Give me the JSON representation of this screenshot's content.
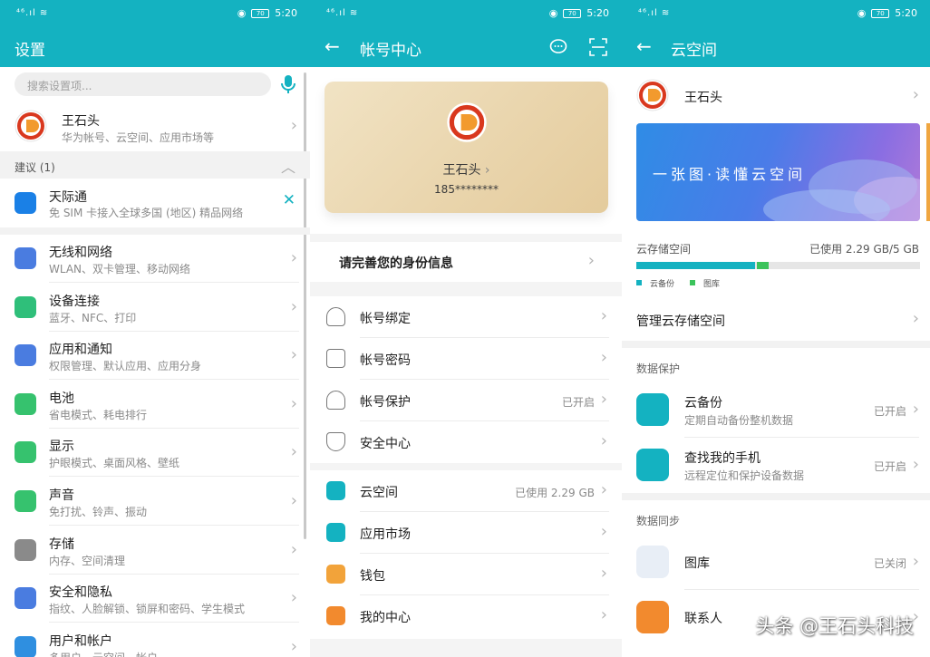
{
  "status": {
    "signal": "⁴⁶.ıl ≋",
    "time": "5:20",
    "battery": "70"
  },
  "settings": {
    "title": "设置",
    "search_placeholder": "搜索设置项...",
    "account": {
      "name": "王石头",
      "desc": "华为帐号、云空间、应用市场等"
    },
    "suggest_header": "建议 (1)",
    "suggest": {
      "title": "天际通",
      "desc": "免 SIM 卡接入全球多国 (地区) 精品网络"
    },
    "items": [
      {
        "title": "无线和网络",
        "desc": "WLAN、双卡管理、移动网络"
      },
      {
        "title": "设备连接",
        "desc": "蓝牙、NFC、打印"
      },
      {
        "title": "应用和通知",
        "desc": "权限管理、默认应用、应用分身"
      },
      {
        "title": "电池",
        "desc": "省电模式、耗电排行"
      },
      {
        "title": "显示",
        "desc": "护眼模式、桌面风格、壁纸"
      },
      {
        "title": "声音",
        "desc": "免打扰、铃声、振动"
      },
      {
        "title": "存储",
        "desc": "内存、空间清理"
      },
      {
        "title": "安全和隐私",
        "desc": "指纹、人脸解锁、锁屏和密码、学生模式"
      },
      {
        "title": "用户和帐户",
        "desc": "多用户、云空间、帐户"
      }
    ]
  },
  "account_center": {
    "title": "帐号中心",
    "name": "王石头",
    "phone": "185********",
    "complete_info": "请完善您的身份信息",
    "items1": [
      {
        "label": "帐号绑定",
        "value": ""
      },
      {
        "label": "帐号密码",
        "value": ""
      },
      {
        "label": "帐号保护",
        "value": "已开启"
      },
      {
        "label": "安全中心",
        "value": ""
      }
    ],
    "items2": [
      {
        "label": "云空间",
        "value": "已使用 2.29 GB"
      },
      {
        "label": "应用市场",
        "value": ""
      },
      {
        "label": "钱包",
        "value": ""
      },
      {
        "label": "我的中心",
        "value": ""
      }
    ]
  },
  "cloud": {
    "title": "云空间",
    "name": "王石头",
    "banner_text": "一张图·读懂云空间",
    "storage_label": "云存储空间",
    "storage_used": "已使用 2.29 GB/5 GB",
    "used_fraction_backup": 0.42,
    "used_fraction_gallery": 0.04,
    "legend": [
      "云备份",
      "图库"
    ],
    "manage": "管理云存储空间",
    "protect_header": "数据保护",
    "protect_items": [
      {
        "title": "云备份",
        "desc": "定期自动备份整机数据",
        "value": "已开启"
      },
      {
        "title": "查找我的手机",
        "desc": "远程定位和保护设备数据",
        "value": "已开启"
      }
    ],
    "sync_header": "数据同步",
    "sync_items": [
      {
        "title": "图库",
        "value": "已关闭"
      },
      {
        "title": "联系人",
        "value": ""
      }
    ],
    "watermark": "头条 @王石头科技"
  },
  "colors": {
    "accent": "#14b2c1",
    "backup": "#14b2c1",
    "gallery": "#3bc35b"
  }
}
